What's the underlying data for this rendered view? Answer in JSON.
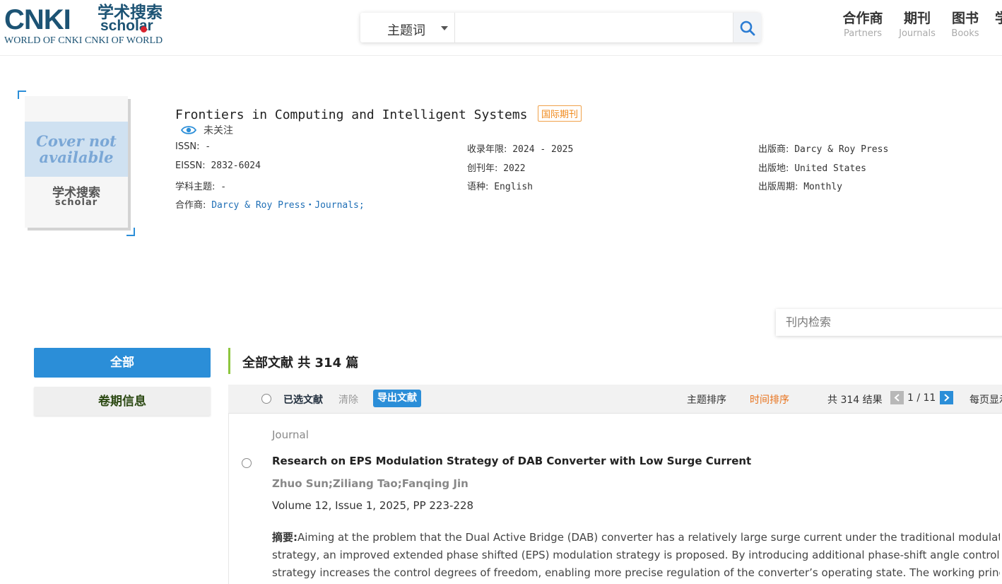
{
  "header": {
    "logo": {
      "main": "CNKI",
      "cn": "学术搜索",
      "en": "scholar",
      "tagline": "WORLD OF CNKI CNKI OF WORLD"
    },
    "search": {
      "type_label": "主题词",
      "placeholder": ""
    },
    "nav": [
      {
        "cn": "合作商",
        "en": "Partners"
      },
      {
        "cn": "期刊",
        "en": "Journals"
      },
      {
        "cn": "图书",
        "en": "Books"
      },
      {
        "cn": "学",
        "en": ""
      }
    ]
  },
  "journal": {
    "cover_text": "Cover not available",
    "cover_logo_cn": "学术搜索",
    "cover_logo_en": "scholar",
    "title": "Frontiers in Computing and Intelligent Systems",
    "badge": "国际期刊",
    "follow_label": "未关注",
    "meta": {
      "issn_label": "ISSN:",
      "issn": "-",
      "eissn_label": "EISSN:",
      "eissn": "2832-6024",
      "subject_label": "学科主题:",
      "subject": "-",
      "partner_label": "合作商:",
      "partner": "Darcy & Roy Press・Journals;",
      "years_label": "收录年限:",
      "years": "2024 - 2025",
      "founded_label": "创刊年:",
      "founded": "2022",
      "language_label": "语种:",
      "language": "English",
      "publisher_label": "出版商:",
      "publisher": "Darcy & Roy Press",
      "place_label": "出版地:",
      "place": "United States",
      "frequency_label": "出版周期:",
      "frequency": "Monthly"
    }
  },
  "inner_search": {
    "placeholder": "刊内检索"
  },
  "tabs": {
    "all": "全部",
    "issue": "卷期信息"
  },
  "results": {
    "heading": "全部文献 共 314 篇",
    "toolbar": {
      "selected": "已选文献",
      "clear": "清除",
      "export": "导出文献",
      "sort_topic": "主题排序",
      "sort_time": "时间排序",
      "total": "共 314 结果",
      "page": "1 / 11",
      "per_page": "每页显示"
    },
    "articles": [
      {
        "type": "Journal",
        "title": "Research on EPS Modulation Strategy of DAB Converter with Low Surge Current",
        "authors": "Zhuo Sun;Ziliang Tao;Fanqing Jin",
        "volume": "Volume 12, Issue 1, 2025, PP 223-228",
        "abstract_label": "摘要:",
        "abstract_lines": [
          "Aiming at the problem that the Dual Active Bridge (DAB) converter has a relatively large surge current under the traditional modulation",
          "strategy, an improved extended phase shifted (EPS) modulation strategy is proposed. By introducing additional phase-shift angle control, this",
          "strategy increases the control degrees of freedom, enabling more precise regulation of the converter’s operating state. The working principl..."
        ]
      }
    ]
  },
  "colors": {
    "brand": "#1c5374",
    "accent": "#2b8ed8",
    "sort_active": "#e8731d",
    "badge": "#f08a1c",
    "link": "#1f6fb6"
  }
}
